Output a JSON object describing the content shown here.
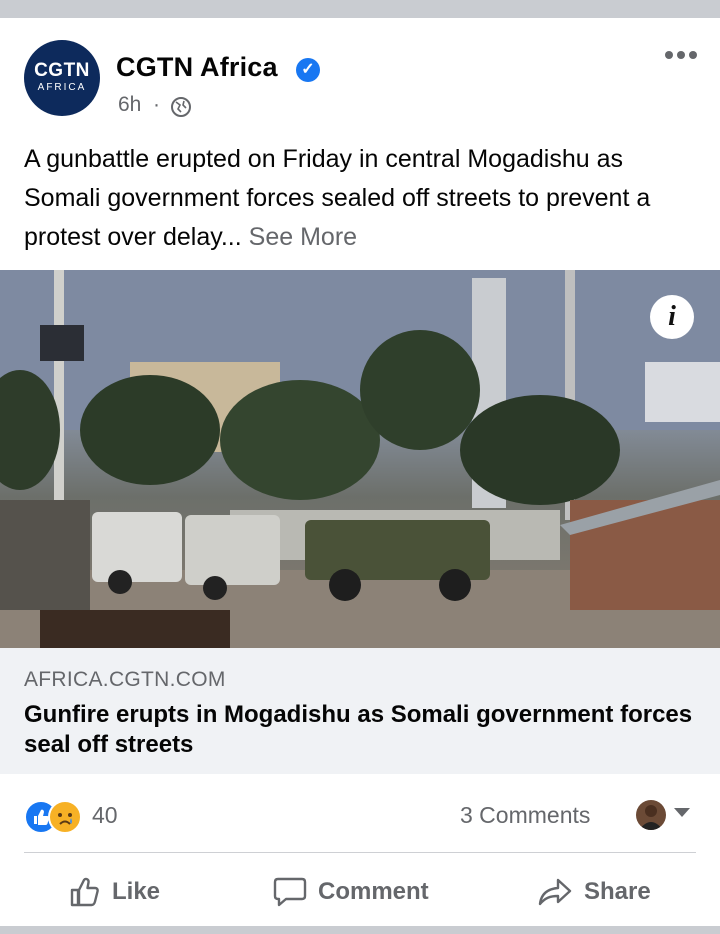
{
  "post": {
    "page_name": "CGTN Africa",
    "avatar_text_top": "CGTN",
    "avatar_text_bottom": "AFRICA",
    "time": "6h",
    "separator": "·",
    "text": "A gunbattle erupted on Friday in central Mogadishu as Somali government forces sealed off streets to prevent a protest over delay...",
    "see_more": "See More",
    "more_icon": "more-horizontal-icon",
    "privacy_icon": "globe-icon",
    "verified_icon": "verified-badge-icon",
    "info_label": "i"
  },
  "link": {
    "domain": "AFRICA.CGTN.COM",
    "headline": "Gunfire erupts in Mogadishu as Somali government forces seal off streets"
  },
  "engagement": {
    "reaction_count": "40",
    "comments": "3 Comments"
  },
  "actions": {
    "like": "Like",
    "comment": "Comment",
    "share": "Share"
  },
  "colors": {
    "brand_blue": "#1877f2",
    "secondary_text": "#65676b",
    "link_bg": "#f0f2f5"
  }
}
